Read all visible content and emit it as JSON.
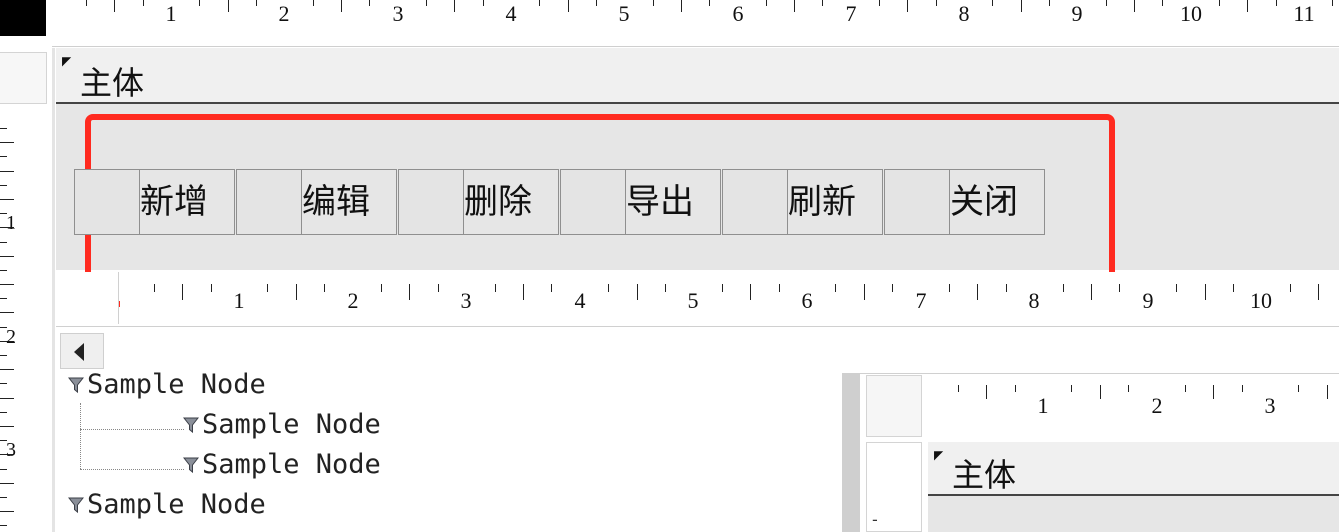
{
  "top_ruler": {
    "labels": [
      "1",
      "2",
      "3",
      "4",
      "5",
      "6",
      "7",
      "8",
      "9",
      "10",
      "11"
    ]
  },
  "left_ruler": {
    "labels": [
      "1",
      "2",
      "3"
    ]
  },
  "form": {
    "title": "主体",
    "toolbar": {
      "buttons": [
        {
          "label": "新增"
        },
        {
          "label": "编辑"
        },
        {
          "label": "删除"
        },
        {
          "label": "导出"
        },
        {
          "label": "刷新"
        },
        {
          "label": "关闭"
        }
      ]
    }
  },
  "lower_ruler": {
    "labels": [
      "1",
      "2",
      "3",
      "4",
      "5",
      "6",
      "7",
      "8",
      "9",
      "10"
    ]
  },
  "tree": {
    "nodes": [
      {
        "label": "Sample Node",
        "level": 0
      },
      {
        "label": "Sample Node",
        "level": 1
      },
      {
        "label": "Sample Node",
        "level": 1
      },
      {
        "label": "Sample Node",
        "level": 0
      }
    ]
  },
  "mini_panel": {
    "ruler_labels": [
      "1",
      "2",
      "3"
    ],
    "title": "主体",
    "gutter_mark": "-"
  },
  "colors": {
    "highlight_border": "#ff2a1f",
    "toolbar_background": "#e6e6e6",
    "header_background": "#f0f0f0"
  },
  "icons": {
    "tree_node": "filter-funnel-icon",
    "scroll_left": "triangle-left-icon"
  }
}
